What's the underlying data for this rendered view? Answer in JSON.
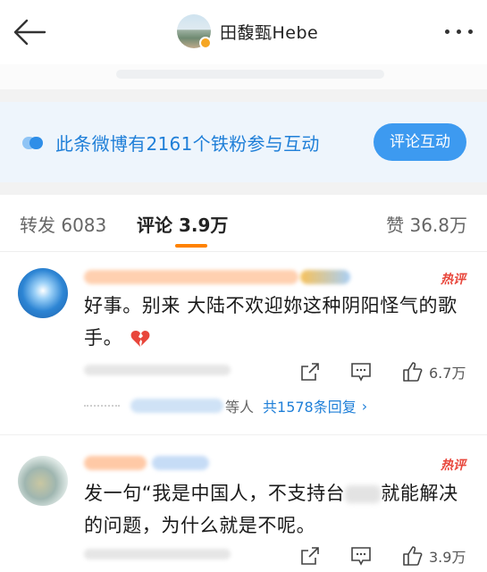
{
  "header": {
    "author_name": "田馥甄Hebe",
    "back_icon": "arrow-left-icon",
    "more_icon": "ellipsis-icon"
  },
  "fans_banner": {
    "text": "此条微博有2161个铁粉参与互动",
    "button_label": "评论互动",
    "accent_color": "#1f7fd8"
  },
  "tabs": [
    {
      "label": "转发 6083"
    },
    {
      "label": "评论 3.9万",
      "active": true
    },
    {
      "label": "赞 36.8万"
    }
  ],
  "comments": [
    {
      "text": "好事。别来 大陆不欢迎妳这种阴阳怪气的歌手。",
      "hot_tag": "热评",
      "emoji": "broken-heart-icon",
      "like_count": "6.7万",
      "replies": {
        "who": "等人",
        "total": "共1578条回复",
        "arrow": "›"
      }
    },
    {
      "text_before": "发一句“我是中国人，不支持台",
      "text_after": "就能解决的问题，为什么就是不呢。",
      "hot_tag": "热评",
      "like_count": "3.9万"
    }
  ]
}
